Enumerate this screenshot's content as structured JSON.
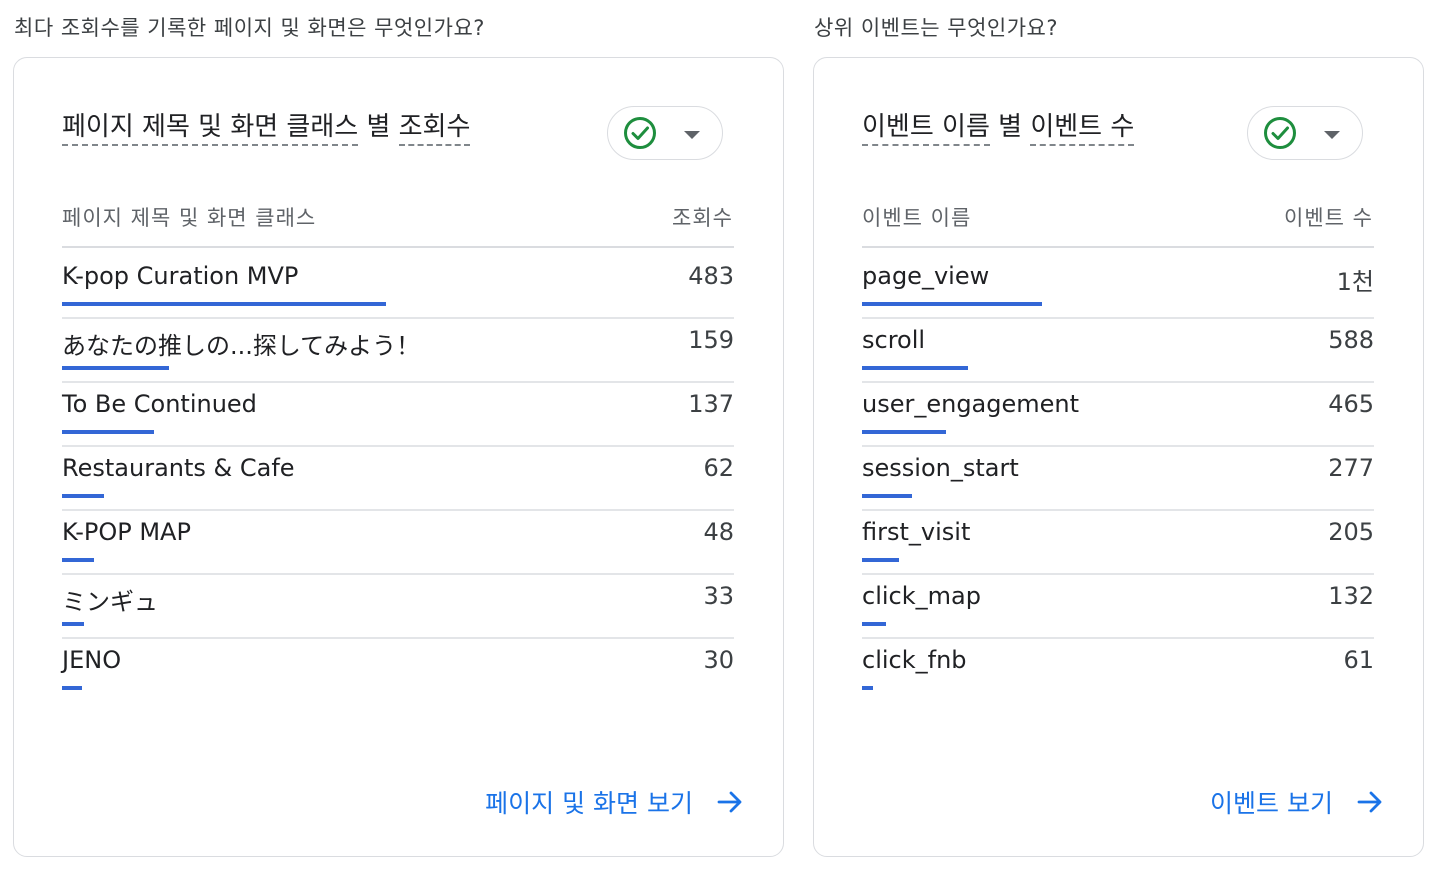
{
  "left": {
    "question": "최다 조회수를 기록한 페이지 및 화면은 무엇인가요?",
    "title_part1": "페이지 제목 및 화면 클래스",
    "title_mid": " 별 ",
    "title_part2": "조회수",
    "col_name": "페이지 제목 및 화면 클래스",
    "col_value": "조회수",
    "rows": [
      {
        "label": "K-pop Curation MVP",
        "value": "483",
        "amount": 483
      },
      {
        "label": "あなたの推しの...探してみよう！",
        "value": "159",
        "amount": 159
      },
      {
        "label": "To Be Continued",
        "value": "137",
        "amount": 137
      },
      {
        "label": "Restaurants & Cafe",
        "value": "62",
        "amount": 62
      },
      {
        "label": "K-POP MAP",
        "value": "48",
        "amount": 48
      },
      {
        "label": "ミンギュ",
        "value": "33",
        "amount": 33
      },
      {
        "label": "JENO",
        "value": "30",
        "amount": 30
      }
    ],
    "link": "페이지 및 화면 보기"
  },
  "right": {
    "question": "상위 이벤트는 무엇인가요?",
    "title_part1": "이벤트 이름",
    "title_mid": " 별 ",
    "title_part2": "이벤트 수",
    "col_name": "이벤트 이름",
    "col_value": "이벤트 수",
    "rows": [
      {
        "label": "page_view",
        "value": "1천",
        "amount": 1000
      },
      {
        "label": "scroll",
        "value": "588",
        "amount": 588
      },
      {
        "label": "user_engagement",
        "value": "465",
        "amount": 465
      },
      {
        "label": "session_start",
        "value": "277",
        "amount": 277
      },
      {
        "label": "first_visit",
        "value": "205",
        "amount": 205
      },
      {
        "label": "click_map",
        "value": "132",
        "amount": 132
      },
      {
        "label": "click_fnb",
        "value": "61",
        "amount": 61
      }
    ],
    "link": "이벤트 보기"
  },
  "icons": {
    "status": "check-circle-icon",
    "dropdown": "caret-down-icon",
    "link_arrow": "arrow-right-icon"
  },
  "colors": {
    "bar": "#3367d6",
    "link": "#1a73e8",
    "check": "#1e8e3e"
  }
}
